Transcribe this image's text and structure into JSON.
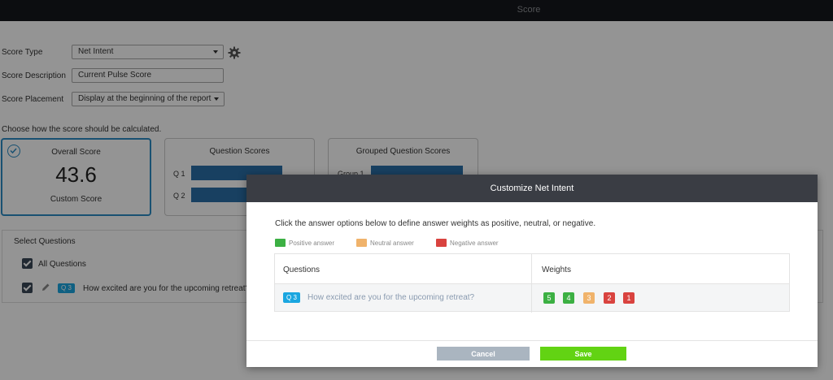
{
  "header": {
    "title": "Score"
  },
  "form": {
    "score_type_label": "Score Type",
    "score_type_value": "Net Intent",
    "score_description_label": "Score Description",
    "score_description_value": "Current Pulse Score",
    "score_placement_label": "Score Placement",
    "score_placement_value": "Display at the beginning of the report",
    "calc_prompt": "Choose how the score should be calculated."
  },
  "cards": {
    "overall": {
      "title": "Overall Score",
      "value": "43.6",
      "subtitle": "Custom Score"
    },
    "question": {
      "title": "Question Scores",
      "bars": [
        {
          "label": "Q 1"
        },
        {
          "label": "Q 2"
        }
      ]
    },
    "grouped": {
      "title": "Grouped Question Scores",
      "bars": [
        {
          "label": "Group 1"
        }
      ]
    }
  },
  "select_questions": {
    "title": "Select Questions",
    "all_label": "All Questions",
    "question_tag": "Q 3",
    "question_text": "How excited are you for the upcoming retreat?"
  },
  "modal": {
    "title": "Customize Net Intent",
    "instructions": "Click the answer options below to define answer weights as positive, neutral, or negative.",
    "legend": [
      {
        "label": "Positive answer",
        "color": "#3cb043"
      },
      {
        "label": "Neutral answer",
        "color": "#f0b36b"
      },
      {
        "label": "Negative answer",
        "color": "#d9433f"
      }
    ],
    "table": {
      "col_questions": "Questions",
      "col_weights": "Weights",
      "row": {
        "tag": "Q 3",
        "text": "How excited are you for the upcoming retreat?",
        "weights": [
          {
            "value": "5",
            "color": "#3cb043"
          },
          {
            "value": "4",
            "color": "#3cb043"
          },
          {
            "value": "3",
            "color": "#f0b36b"
          },
          {
            "value": "2",
            "color": "#d9433f"
          },
          {
            "value": "1",
            "color": "#d9433f"
          }
        ]
      }
    },
    "cancel_label": "Cancel",
    "save_label": "Save"
  }
}
